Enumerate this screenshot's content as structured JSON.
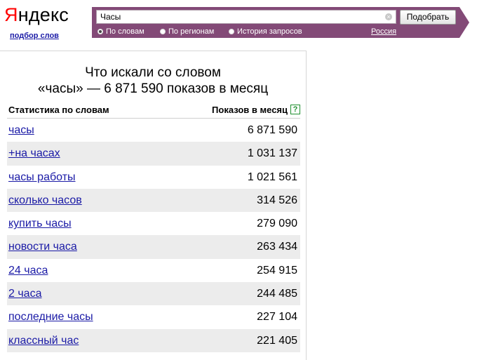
{
  "header": {
    "logo_first": "Я",
    "logo_rest": "ндекс",
    "sublogo": "подбор слов"
  },
  "search": {
    "value": "Часы",
    "button_label": "Подобрать",
    "clear_icon": "close-icon",
    "modes": [
      {
        "label": "По словам",
        "selected": true
      },
      {
        "label": "По регионам",
        "selected": false
      },
      {
        "label": "История запросов",
        "selected": false
      }
    ],
    "region": "Россия"
  },
  "results": {
    "heading_line1": "Что искали со словом",
    "heading_line2": "«часы» — 6 871 590 показов в месяц",
    "col_keyword": "Статистика по словам",
    "col_count": "Показов в месяц",
    "help_icon_label": "?",
    "rows": [
      {
        "keyword": "часы",
        "count": "6 871 590"
      },
      {
        "keyword": "+на часах",
        "count": "1 031 137"
      },
      {
        "keyword": "часы работы",
        "count": "1 021 561"
      },
      {
        "keyword": "сколько часов",
        "count": "314 526"
      },
      {
        "keyword": "купить часы",
        "count": "279 090"
      },
      {
        "keyword": "новости часа",
        "count": "263 434"
      },
      {
        "keyword": "24 часа",
        "count": "254 915"
      },
      {
        "keyword": "2 часа",
        "count": "244 485"
      },
      {
        "keyword": "последние часы",
        "count": "227 104"
      },
      {
        "keyword": "классный час",
        "count": "221 405"
      }
    ]
  },
  "colors": {
    "bar": "#834a77",
    "link": "#1a1aa6",
    "logo_red": "#ff0000",
    "row_alt": "#ececec"
  }
}
